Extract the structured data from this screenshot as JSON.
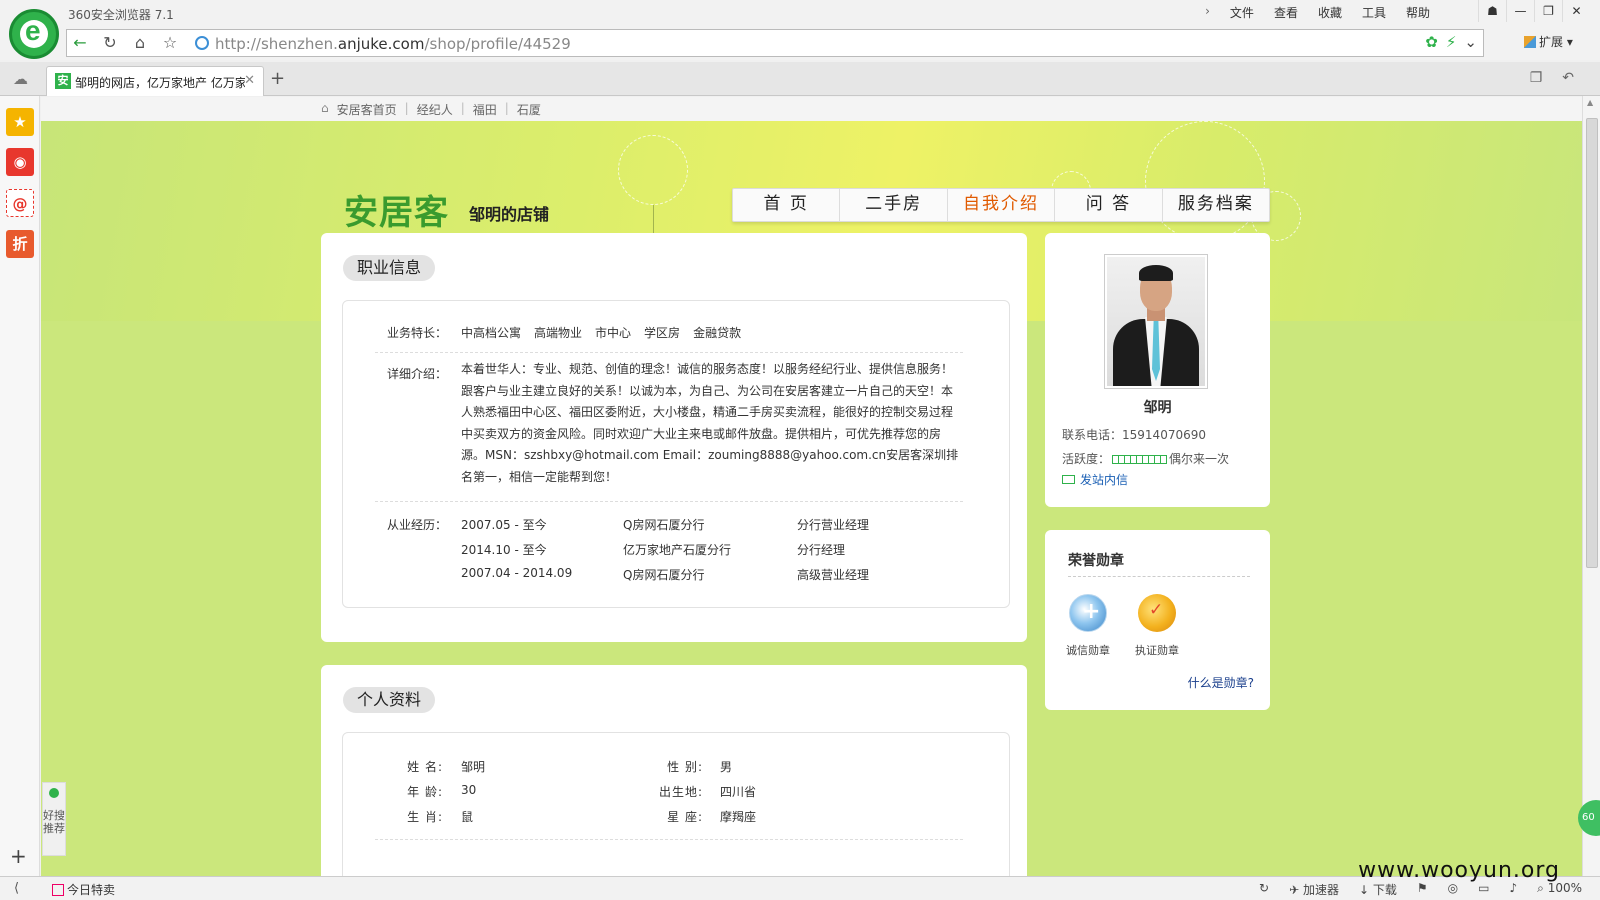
{
  "browser": {
    "app_title": "360安全浏览器 7.1",
    "menu": [
      "文件",
      "查看",
      "收藏",
      "工具",
      "帮助"
    ],
    "url_prefix": "http://shenzhen.",
    "url_domain": "anjuke.com",
    "url_path": "/shop/profile/44529",
    "extensions_label": "扩展",
    "tab_title": "邹明的网店，亿万家地产 亿万家",
    "tab_favicon": "安",
    "status": {
      "today_sale": "今日特卖",
      "accelerator": "加速器",
      "download": "下载",
      "zoom": "100%"
    },
    "haosou": "好搜推荐",
    "ball": "60",
    "watermark": "www.wooyun.org"
  },
  "breadcrumb": [
    "安居客首页",
    "经纪人",
    "福田",
    "石厦"
  ],
  "header": {
    "logo": "安居客",
    "shop_name": "邹明的店铺",
    "nav": [
      "首 页",
      "二手房",
      "自我介绍",
      "问 答",
      "服务档案"
    ],
    "active_nav": 2,
    "active_color": "#e05a00"
  },
  "career": {
    "title": "职业信息",
    "specialty_label": "业务特长：",
    "specialties": [
      "中高档公寓",
      "高端物业",
      "市中心",
      "学区房",
      "金融贷款"
    ],
    "detail_label": "详细介绍：",
    "detail": "本着世华人：专业、规范、创值的理念！诚信的服务态度！以服务经纪行业、提供信息服务！跟客户与业主建立良好的关系！以诚为本，为自己、为公司在安居客建立一片自己的天空！本人熟悉福田中心区、福田区委附近，大小楼盘，精通二手房买卖流程，能很好的控制交易过程中买卖双方的资金风险。同时欢迎广大业主来电或邮件放盘。提供相片，可优先推荐您的房源。MSN：szshbxy@hotmail.com Email：zouming8888@yahoo.com.cn安居客深圳排名第一，相信一定能帮到您！",
    "experience_label": "从业经历：",
    "experience": [
      {
        "period": "2007.05 - 至今",
        "company": "Q房网石厦分行",
        "position": "分行营业经理"
      },
      {
        "period": "2014.10 - 至今",
        "company": "亿万家地产石厦分行",
        "position": "分行经理"
      },
      {
        "period": "2007.04 - 2014.09",
        "company": "Q房网石厦分行",
        "position": "高级营业经理"
      }
    ]
  },
  "personal": {
    "title": "个人资料",
    "fields": [
      {
        "label": "姓  名:",
        "value": "邹明"
      },
      {
        "label": "性  别:",
        "value": "男"
      },
      {
        "label": "年  龄:",
        "value": "30"
      },
      {
        "label": "出生地:",
        "value": "四川省"
      },
      {
        "label": "生  肖:",
        "value": "鼠"
      },
      {
        "label": "星  座:",
        "value": "摩羯座"
      }
    ]
  },
  "agent": {
    "name": "邹明",
    "phone_label": "联系电话：",
    "phone": "15914070690",
    "activity_label": "活跃度：",
    "activity_text": "偶尔来一次",
    "activity_color": "#2fb24b",
    "message_link": "发站内信"
  },
  "honors": {
    "title": "荣誉勋章",
    "badges": [
      {
        "label": "诚信勋章",
        "icon": "shield-icon"
      },
      {
        "label": "执证勋章",
        "icon": "medal-icon"
      }
    ],
    "what_link": "什么是勋章?"
  }
}
